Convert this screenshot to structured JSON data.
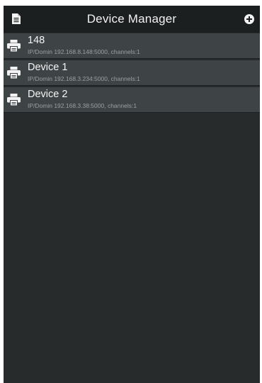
{
  "header": {
    "title": "Device Manager",
    "left_icon": "document-icon",
    "right_icon": "add-circle-icon"
  },
  "devices": [
    {
      "name": "148",
      "detail": "IP/Domin 192.168.8.148:5000, channels:1",
      "icon": "printer-icon"
    },
    {
      "name": "Device 1",
      "detail": "IP/Domin 192.168.3.234:5000, channels:1",
      "icon": "printer-icon"
    },
    {
      "name": "Device 2",
      "detail": "IP/Domin 192.168.3.38:5000, channels:1",
      "icon": "printer-icon"
    }
  ],
  "colors": {
    "background": "#272b2c",
    "header": "#1c1f20",
    "row": "#3e4446",
    "text": "#f4f4f4",
    "subtext": "#9aa0a2"
  }
}
